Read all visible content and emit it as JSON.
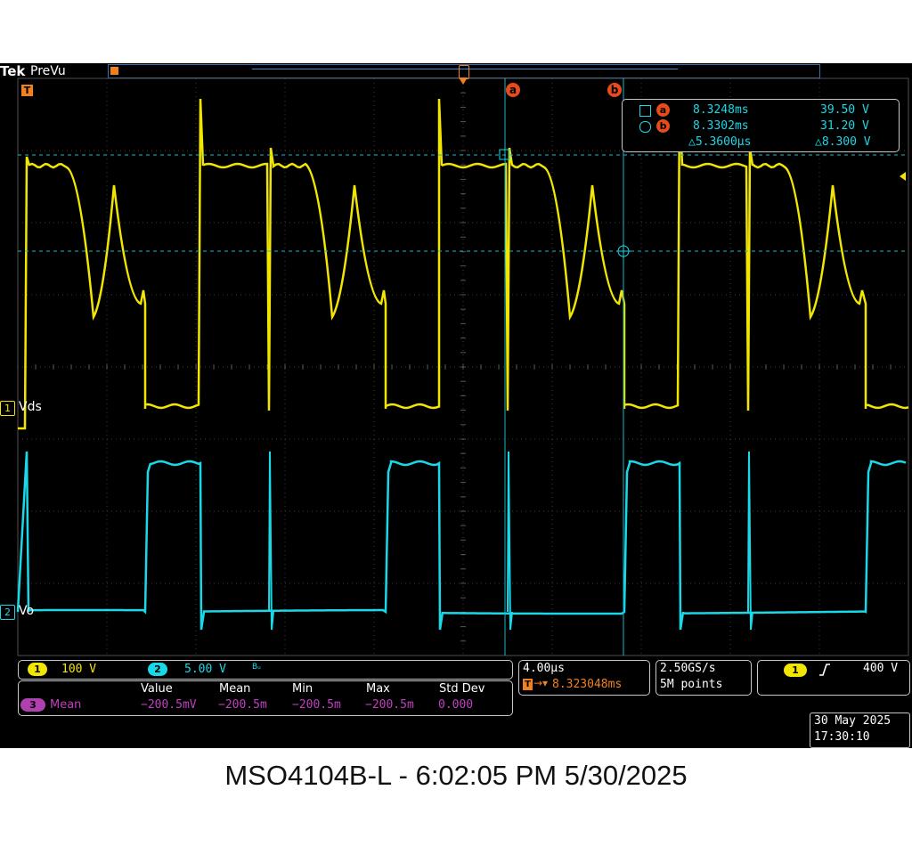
{
  "header": {
    "brand": "Tek",
    "mode": "PreVu",
    "trigger_marker": "T"
  },
  "cursors": {
    "a_label": "a",
    "b_label": "b",
    "readout": {
      "a_time": "8.3248ms",
      "a_value": "39.50 V",
      "b_time": "8.3302ms",
      "b_value": "31.20 V",
      "delta_time": "△5.3600µs",
      "delta_value": "△8.300 V"
    }
  },
  "channels": {
    "ch1": {
      "number": "1",
      "label": "Vds",
      "scale": "100 V",
      "color": "#f2e600"
    },
    "ch2": {
      "number": "2",
      "label": "Vo",
      "scale": "5.00 V",
      "color": "#19d8e8",
      "bw_flag": "Bᵤ"
    }
  },
  "measurement": {
    "headers": [
      "Value",
      "Mean",
      "Min",
      "Max",
      "Std Dev"
    ],
    "row": {
      "channel": "3",
      "name": "Mean",
      "values": [
        "−200.5mV",
        "−200.5m",
        "−200.5m",
        "−200.5m",
        "0.000"
      ]
    },
    "color": "#c040c0"
  },
  "timebase": {
    "scale": "4.00µs",
    "position": "8.323048ms",
    "position_prefix": "T"
  },
  "acquisition": {
    "rate": "2.50GS/s",
    "record": "5M points"
  },
  "trigger": {
    "source": "1",
    "slope_icon": "rising-edge-icon",
    "level": "400 V"
  },
  "datetime": {
    "date": "30 May 2025",
    "time": "17:30:10"
  },
  "footer": "MSO4104B-L - 6:02:05 PM    5/30/2025"
}
